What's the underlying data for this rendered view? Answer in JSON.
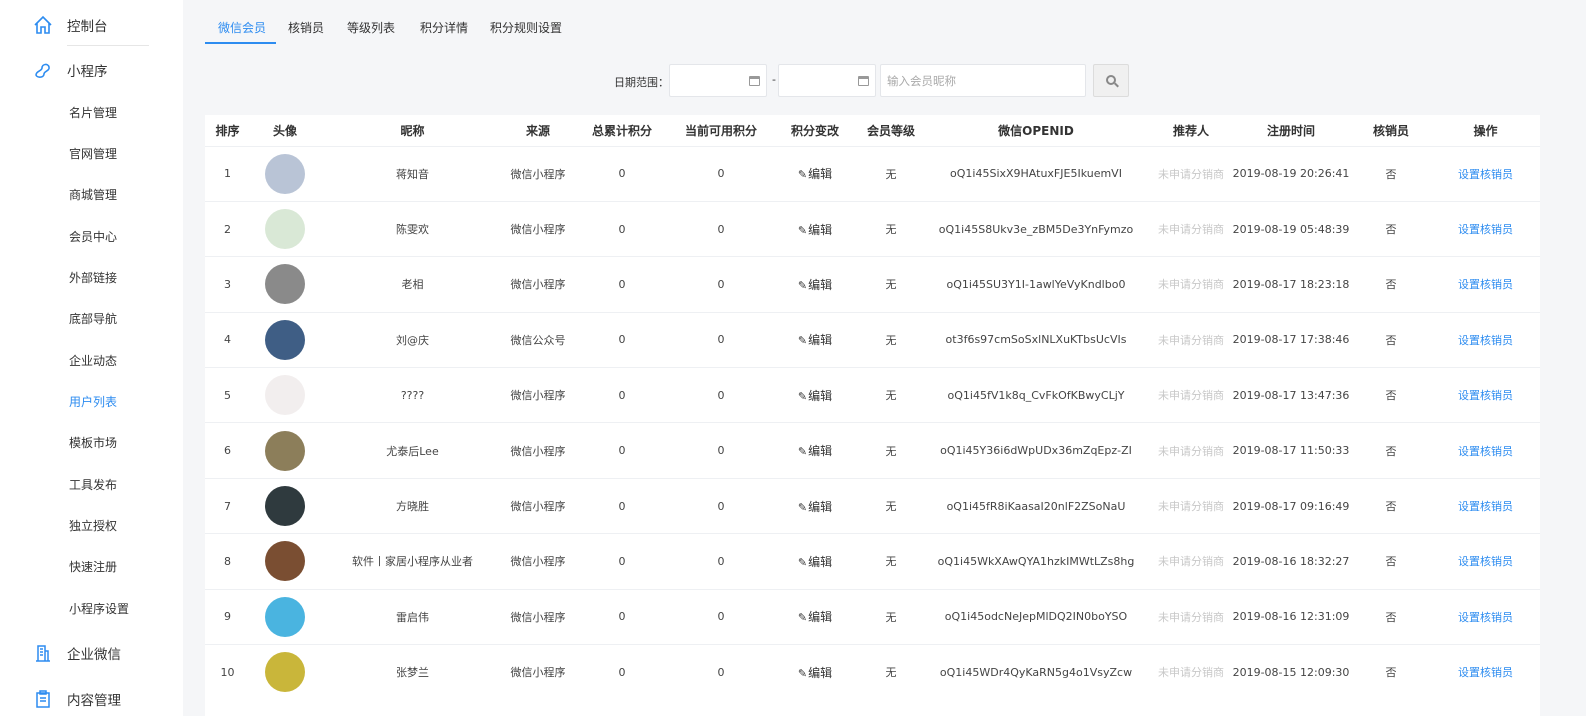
{
  "sidebar": {
    "groups": [
      {
        "label": "控制台",
        "icon": "home-icon"
      },
      {
        "label": "小程序",
        "icon": "mini-program-icon"
      },
      {
        "label": "企业微信",
        "icon": "building-icon"
      },
      {
        "label": "内容管理",
        "icon": "clipboard-icon"
      }
    ],
    "items": [
      {
        "label": "名片管理"
      },
      {
        "label": "官网管理"
      },
      {
        "label": "商城管理"
      },
      {
        "label": "会员中心"
      },
      {
        "label": "外部链接"
      },
      {
        "label": "底部导航"
      },
      {
        "label": "企业动态"
      },
      {
        "label": "用户列表",
        "active": true
      },
      {
        "label": "模板市场"
      },
      {
        "label": "工具发布"
      },
      {
        "label": "独立授权"
      },
      {
        "label": "快速注册"
      },
      {
        "label": "小程序设置"
      }
    ],
    "accent": "#2d8cf0"
  },
  "tabs": [
    {
      "label": "微信会员",
      "active": true
    },
    {
      "label": "核销员"
    },
    {
      "label": "等级列表"
    },
    {
      "label": "积分详情"
    },
    {
      "label": "积分规则设置"
    }
  ],
  "filter": {
    "date_label": "日期范围：",
    "dash": "-",
    "search_placeholder": "输入会员昵称"
  },
  "table": {
    "headers": [
      "排序",
      "头像",
      "昵称",
      "来源",
      "总累计积分",
      "当前可用积分",
      "积分变改",
      "会员等级",
      "微信OPENID",
      "推荐人",
      "注册时间",
      "核销员",
      "操作"
    ],
    "edit_label": "编辑",
    "rows": [
      {
        "index": "1",
        "nickname": "蒋知音",
        "source": "微信小程序",
        "total": "0",
        "available": "0",
        "level": "无",
        "openid": "oQ1i45SixX9HAtuxFJE5IkuemVI",
        "referrer": "未申请分销商",
        "reg_time": "2019-08-19 20:26:41",
        "verifier": "否",
        "action": "设置核销员",
        "avatar_color": "#b9c4d6"
      },
      {
        "index": "2",
        "nickname": "陈雯欢",
        "source": "微信小程序",
        "total": "0",
        "available": "0",
        "level": "无",
        "openid": "oQ1i45S8Ukv3e_zBM5De3YnFymzo",
        "referrer": "未申请分销商",
        "reg_time": "2019-08-19 05:48:39",
        "verifier": "否",
        "action": "设置核销员",
        "avatar_color": "#d9e8d6"
      },
      {
        "index": "3",
        "nickname": "老相",
        "source": "微信小程序",
        "total": "0",
        "available": "0",
        "level": "无",
        "openid": "oQ1i45SU3Y1I-1awlYeVyKndlbo0",
        "referrer": "未申请分销商",
        "reg_time": "2019-08-17 18:23:18",
        "verifier": "否",
        "action": "设置核销员",
        "avatar_color": "#8a8a8a"
      },
      {
        "index": "4",
        "nickname": "刘@庆",
        "source": "微信公众号",
        "total": "0",
        "available": "0",
        "level": "无",
        "openid": "ot3f6s97cmSoSxlNLXuKTbsUcVIs",
        "referrer": "未申请分销商",
        "reg_time": "2019-08-17 17:38:46",
        "verifier": "否",
        "action": "设置核销员",
        "avatar_color": "#3f5e85"
      },
      {
        "index": "5",
        "nickname": "????",
        "source": "微信小程序",
        "total": "0",
        "available": "0",
        "level": "无",
        "openid": "oQ1i45fV1k8q_CvFkOfKBwyCLjY",
        "referrer": "未申请分销商",
        "reg_time": "2019-08-17 13:47:36",
        "verifier": "否",
        "action": "设置核销员",
        "avatar_color": "#f2eeee"
      },
      {
        "index": "6",
        "nickname": "尤泰后Lee",
        "source": "微信小程序",
        "total": "0",
        "available": "0",
        "level": "无",
        "openid": "oQ1i45Y36i6dWpUDx36mZqEpz-ZI",
        "referrer": "未申请分销商",
        "reg_time": "2019-08-17 11:50:33",
        "verifier": "否",
        "action": "设置核销员",
        "avatar_color": "#8c7e5a"
      },
      {
        "index": "7",
        "nickname": "方晓胜",
        "source": "微信小程序",
        "total": "0",
        "available": "0",
        "level": "无",
        "openid": "oQ1i45fR8iKaasaI20nlF2ZSoNaU",
        "referrer": "未申请分销商",
        "reg_time": "2019-08-17 09:16:49",
        "verifier": "否",
        "action": "设置核销员",
        "avatar_color": "#2f3a3e"
      },
      {
        "index": "8",
        "nickname": "软件丨家居小程序从业者",
        "source": "微信小程序",
        "total": "0",
        "available": "0",
        "level": "无",
        "openid": "oQ1i45WkXAwQYA1hzkIMWtLZs8hg",
        "referrer": "未申请分销商",
        "reg_time": "2019-08-16 18:32:27",
        "verifier": "否",
        "action": "设置核销员",
        "avatar_color": "#7a4e32"
      },
      {
        "index": "9",
        "nickname": "雷启伟",
        "source": "微信小程序",
        "total": "0",
        "available": "0",
        "level": "无",
        "openid": "oQ1i45odcNeJepMlDQ2IN0boYSO",
        "referrer": "未申请分销商",
        "reg_time": "2019-08-16 12:31:09",
        "verifier": "否",
        "action": "设置核销员",
        "avatar_color": "#4ab4e0"
      },
      {
        "index": "10",
        "nickname": "张梦兰",
        "source": "微信小程序",
        "total": "0",
        "available": "0",
        "level": "无",
        "openid": "oQ1i45WDr4QyKaRN5g4o1VsyZcw",
        "referrer": "未申请分销商",
        "reg_time": "2019-08-15 12:09:30",
        "verifier": "否",
        "action": "设置核销员",
        "avatar_color": "#c9b63a"
      }
    ]
  }
}
